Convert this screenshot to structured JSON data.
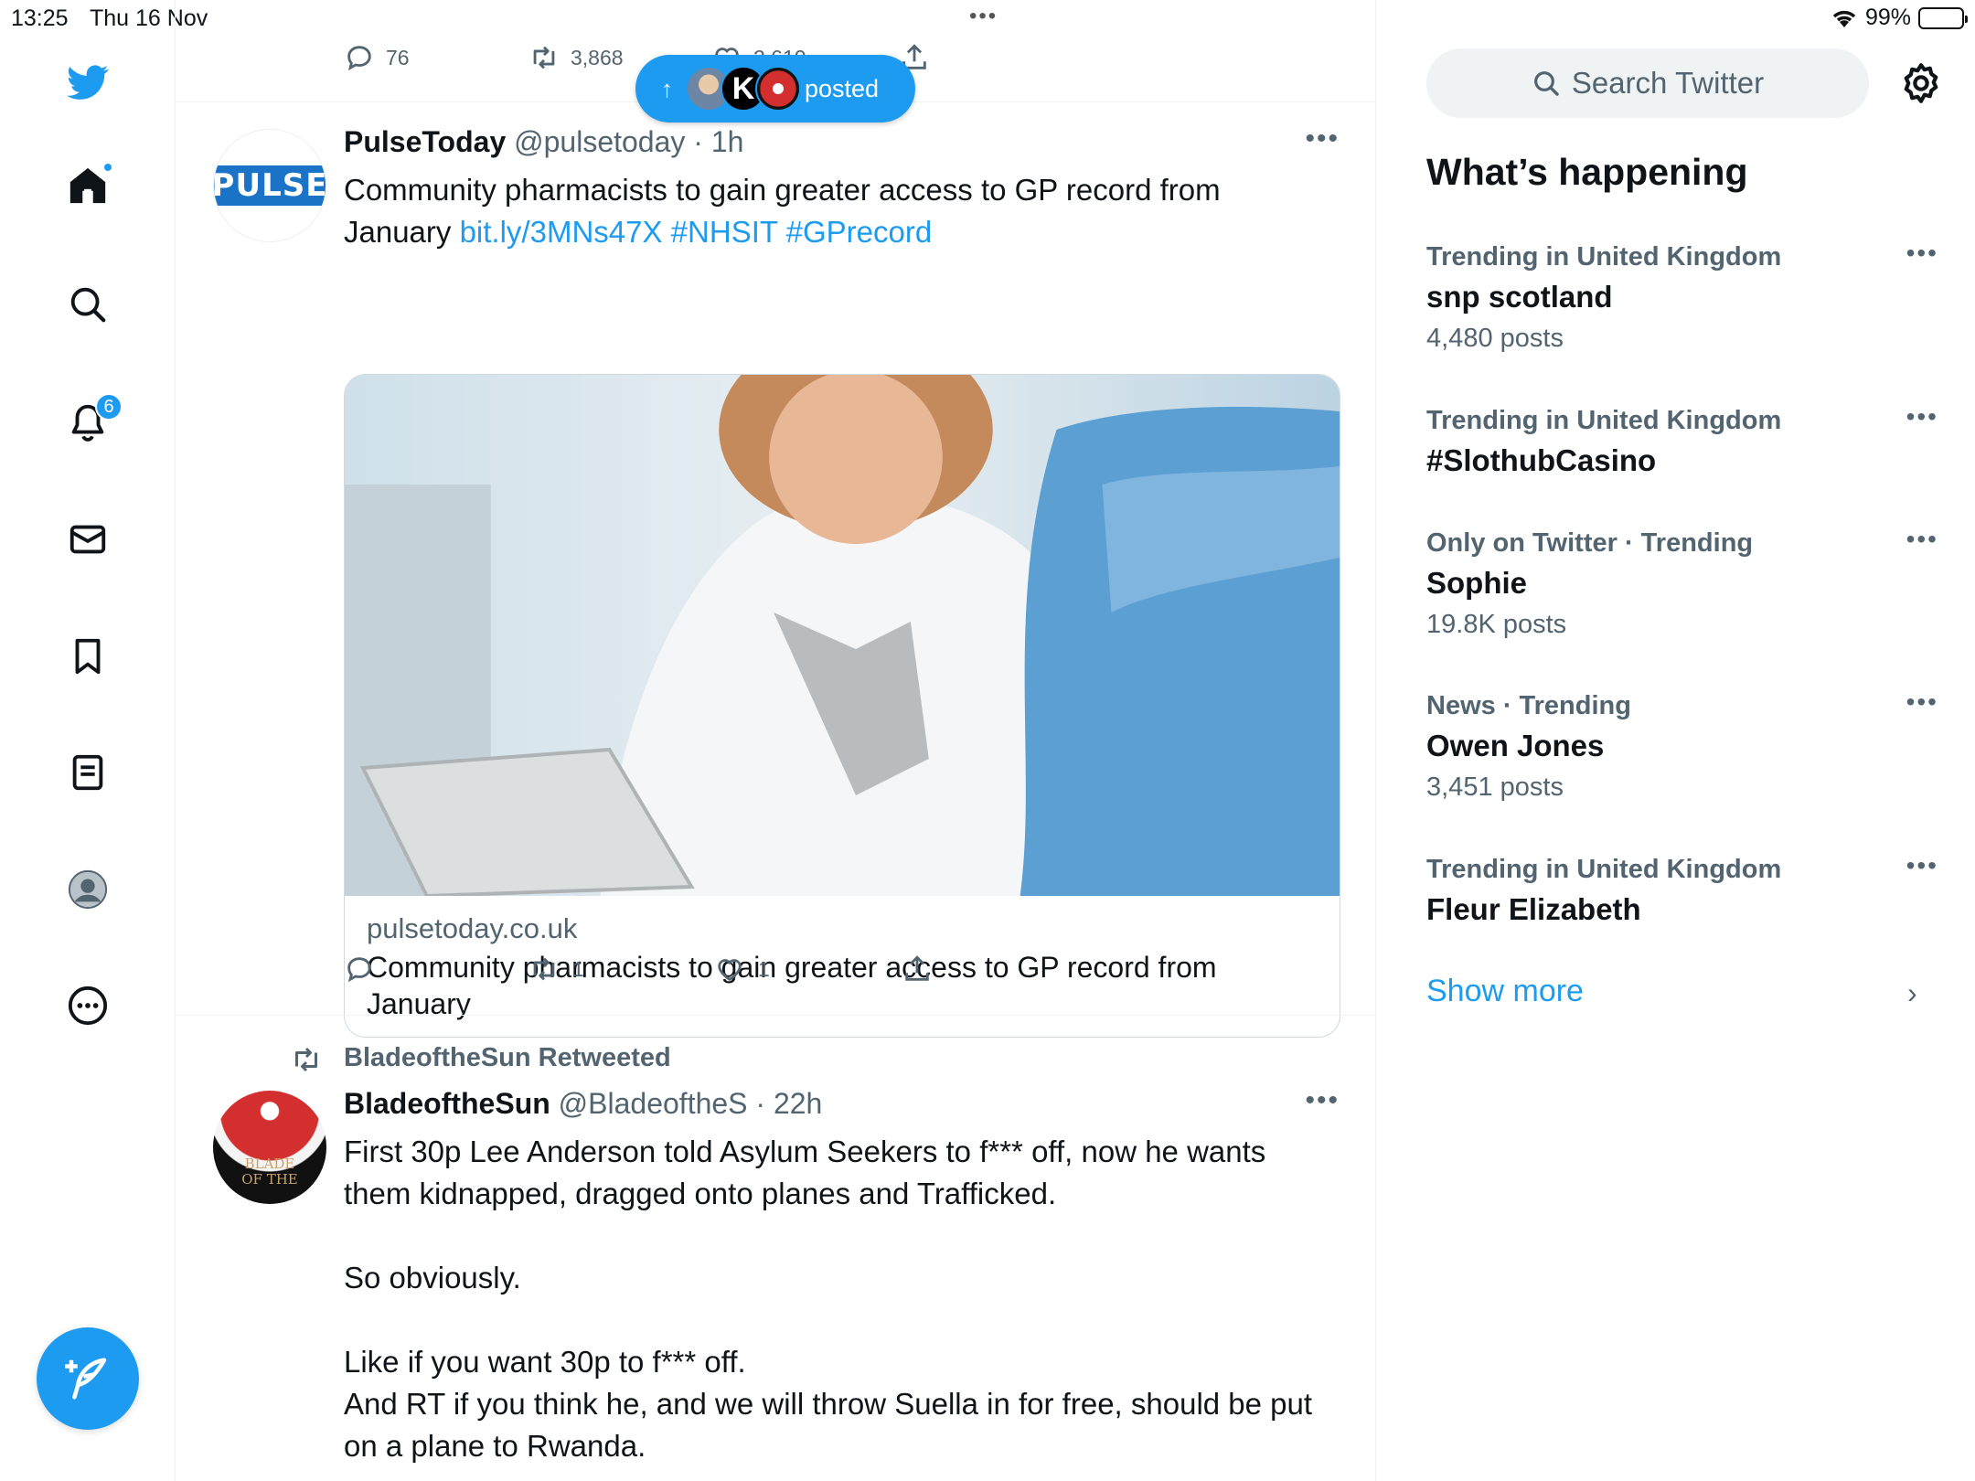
{
  "status_bar": {
    "time": "13:25",
    "date": "Thu 16 Nov",
    "battery": "99%"
  },
  "nav": {
    "notifications_count": "6"
  },
  "top_tweet_actions": {
    "replies": "76",
    "retweets": "3,868",
    "likes": "2,610"
  },
  "new_posts_pill": {
    "label": "posted"
  },
  "tweets": [
    {
      "name": "PulseToday",
      "handle": "@pulsetoday",
      "time": "1h",
      "avatar_text": "PULSE",
      "text": "Community pharmacists to gain greater access to GP record from January ",
      "link": "bit.ly/3MNs47X",
      "hashtags": "#NHSIT #GPrecord",
      "card": {
        "domain": "pulsetoday.co.uk",
        "title": "Community pharmacists to gain greater access to GP record from January"
      },
      "retweets": "1",
      "likes": "1"
    },
    {
      "retweeted_by": "BladeoftheSun Retweeted",
      "name": "BladeoftheSun",
      "handle": "@BladeoftheS",
      "time": "22h",
      "avatar_text": "BLADE OF THE",
      "paragraphs": [
        "First 30p Lee Anderson told Asylum Seekers to f*** off, now he wants them kidnapped, dragged onto planes and Trafficked.",
        "So obviously.",
        "Like if you want 30p to f*** off.",
        "And RT if you think he, and we will throw Suella in for free, should be put on a plane to Rwanda."
      ]
    }
  ],
  "sidebar": {
    "search_placeholder": "Search Twitter",
    "title": "What’s happening",
    "trends": [
      {
        "context": "Trending in United Kingdom",
        "topic": "snp scotland",
        "count": "4,480 posts"
      },
      {
        "context": "Trending in United Kingdom",
        "topic": "#SlothubCasino",
        "count": ""
      },
      {
        "context": "Only on Twitter · Trending",
        "topic": "Sophie",
        "count": "19.8K posts"
      },
      {
        "context": "News · Trending",
        "topic": "Owen Jones",
        "count": "3,451 posts"
      },
      {
        "context": "Trending in United Kingdom",
        "topic": "Fleur Elizabeth",
        "count": ""
      }
    ],
    "show_more": "Show more"
  },
  "colors": {
    "accent": "#1d9bf0",
    "text": "#0f1419",
    "muted": "#536471"
  }
}
